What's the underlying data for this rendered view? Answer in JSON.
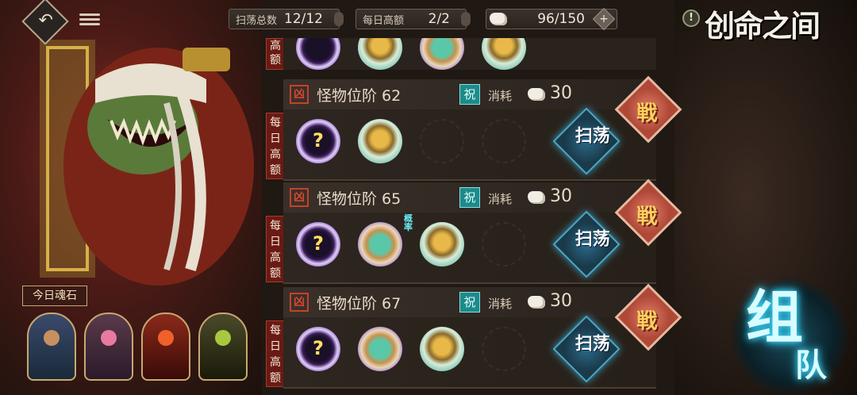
{
  "topbar": {
    "sweep_total_label": "扫荡总数",
    "sweep_total_value": "12/12",
    "daily_high_label": "每日高额",
    "daily_high_value": "2/2",
    "stamina_value": "96/150",
    "plus_symbol": "+",
    "help_symbol": "!"
  },
  "page_title": "创命之间",
  "daily_tag": "每日高额",
  "rows": [
    {
      "tier_label": "怪物位阶",
      "tier_value": "62",
      "cost_label": "消耗",
      "cost_value": "30",
      "rewards": [
        "mystery-orb",
        "gold-bottle"
      ],
      "sweep_label": "扫荡",
      "fight_label": "戦"
    },
    {
      "tier_label": "怪物位阶",
      "tier_value": "65",
      "cost_label": "消耗",
      "cost_value": "30",
      "rewards": [
        "mystery-orb",
        "spirit-grass",
        "gold-bottle"
      ],
      "badge": "概率",
      "sweep_label": "扫荡",
      "fight_label": "戦"
    },
    {
      "tier_label": "怪物位阶",
      "tier_value": "67",
      "cost_label": "消耗",
      "cost_value": "30",
      "rewards": [
        "mystery-orb",
        "spirit-grass",
        "gold-bottle"
      ],
      "sweep_label": "扫荡",
      "fight_label": "戦"
    }
  ],
  "soul_stones": {
    "label": "今日魂石",
    "items": [
      "warrior-portrait",
      "winged-spirit-portrait",
      "flame-demon-portrait",
      "golem-portrait"
    ]
  },
  "team_button": {
    "line1": "组",
    "line2": "队"
  },
  "colors": {
    "accent_red": "#c8402a",
    "accent_cyan": "#38d8ff",
    "gold": "#c8a870"
  }
}
